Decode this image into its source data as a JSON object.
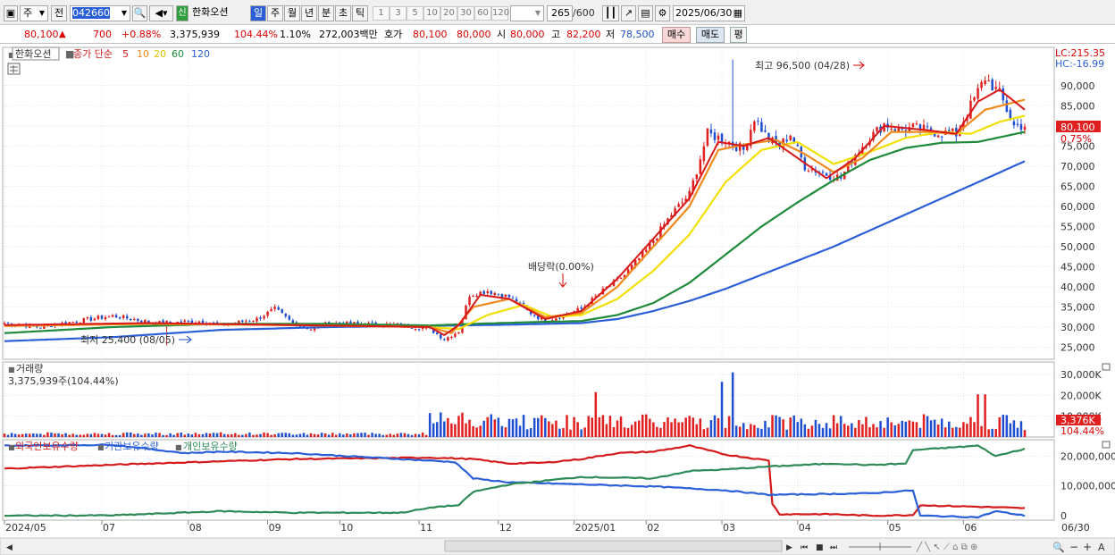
{
  "toolbar": {
    "period_type": "주",
    "prev_label": "전",
    "stock_code": "042660",
    "market_badge": "신",
    "stock_name": "한화오션",
    "intervals": [
      "일",
      "주",
      "월",
      "년",
      "분",
      "초",
      "틱"
    ],
    "active_interval": "일",
    "periods": [
      "1",
      "3",
      "5",
      "10",
      "20",
      "30",
      "60",
      "120"
    ],
    "count": "265",
    "count_total": "/600",
    "date": "2025/06/30"
  },
  "quote": {
    "price": "80,100",
    "change": "700",
    "change_pct": "+0.88%",
    "volume": "3,375,939",
    "volume_ratio": "104.44%",
    "turnover": "1.10%",
    "amount": "272,003백만",
    "hoga_label": "호가",
    "hoga1": "80,100",
    "hoga2": "80,000",
    "open_label": "시",
    "open": "80,000",
    "high_label": "고",
    "high": "82,200",
    "low_label": "저",
    "low": "78,500",
    "buy_label": "매수",
    "sell_label": "매도",
    "eval_label": "평"
  },
  "colors": {
    "up": "#e02020",
    "down": "#1f4fd1",
    "ma5": "#d81818",
    "ma10": "#f08a1c",
    "ma20": "#f2e000",
    "ma60": "#1e8a3a",
    "ma120": "#2b5fd8",
    "foreign": "#d41c1c",
    "institution": "#2b5fd8",
    "individual": "#2e8b57"
  },
  "chart_data": [
    {
      "type": "candlestick",
      "title": "한화오션",
      "legend": {
        "label": "종가 단순",
        "periods": [
          "5",
          "10",
          "20",
          "60",
          "120"
        ]
      },
      "y_tick_labels": [
        "25,000",
        "30,000",
        "35,000",
        "40,000",
        "45,000",
        "50,000",
        "55,000",
        "60,000",
        "65,000",
        "70,000",
        "75,000",
        "80,000",
        "85,000",
        "90,000"
      ],
      "ylim": [
        22000,
        99500
      ],
      "lc_label": "LC:215.35",
      "hc_label": "HC:-16.99",
      "last_price_label": "80,100",
      "last_change_label": "0.75%",
      "annotations": {
        "high": "최고 96,500 (04/28)",
        "low": "최저 25,400 (08/05)",
        "dividend": "배당락(0.00%)"
      },
      "price_points": [
        [
          0,
          31000
        ],
        [
          10,
          30000
        ],
        [
          20,
          31500
        ],
        [
          30,
          32800
        ],
        [
          42,
          31000
        ],
        [
          55,
          31500
        ],
        [
          60,
          30500
        ],
        [
          70,
          32000
        ],
        [
          75,
          34500
        ],
        [
          80,
          31000
        ],
        [
          85,
          29500
        ],
        [
          90,
          31000
        ],
        [
          100,
          30800
        ],
        [
          110,
          30500
        ],
        [
          118,
          29500
        ],
        [
          122,
          27000
        ],
        [
          126,
          29000
        ],
        [
          129,
          38000
        ],
        [
          134,
          39000
        ],
        [
          140,
          37500
        ],
        [
          145,
          34000
        ],
        [
          150,
          31500
        ],
        [
          155,
          33000
        ],
        [
          160,
          34500
        ],
        [
          166,
          39000
        ],
        [
          172,
          43000
        ],
        [
          178,
          49000
        ],
        [
          185,
          58000
        ],
        [
          190,
          63000
        ],
        [
          195,
          78000
        ],
        [
          200,
          76500
        ],
        [
          205,
          74000
        ],
        [
          208,
          82000
        ],
        [
          212,
          76500
        ],
        [
          215,
          75000
        ],
        [
          218,
          78000
        ],
        [
          222,
          70000
        ],
        [
          228,
          68000
        ],
        [
          232,
          67000
        ],
        [
          236,
          73000
        ],
        [
          240,
          77000
        ],
        [
          244,
          80500
        ],
        [
          248,
          79000
        ],
        [
          252,
          79500
        ],
        [
          258,
          78500
        ],
        [
          264,
          78000
        ],
        [
          268,
          85000
        ],
        [
          272,
          92000
        ],
        [
          276,
          88000
        ],
        [
          280,
          80000
        ],
        [
          283,
          80100
        ]
      ],
      "ma_points": {
        "5": [
          [
            0,
            30500
          ],
          [
            40,
            31000
          ],
          [
            80,
            30500
          ],
          [
            118,
            30000
          ],
          [
            122,
            28000
          ],
          [
            126,
            30500
          ],
          [
            132,
            38000
          ],
          [
            140,
            37000
          ],
          [
            150,
            32000
          ],
          [
            160,
            34000
          ],
          [
            170,
            42000
          ],
          [
            180,
            52000
          ],
          [
            190,
            62000
          ],
          [
            198,
            76000
          ],
          [
            205,
            75000
          ],
          [
            212,
            77000
          ],
          [
            220,
            72000
          ],
          [
            228,
            67000
          ],
          [
            236,
            72000
          ],
          [
            244,
            80000
          ],
          [
            255,
            79000
          ],
          [
            264,
            78000
          ],
          [
            270,
            86000
          ],
          [
            276,
            89000
          ],
          [
            283,
            84000
          ]
        ],
        "10": [
          [
            0,
            30300
          ],
          [
            40,
            30800
          ],
          [
            80,
            30500
          ],
          [
            118,
            30000
          ],
          [
            124,
            28500
          ],
          [
            130,
            35000
          ],
          [
            140,
            37000
          ],
          [
            150,
            32500
          ],
          [
            160,
            33500
          ],
          [
            170,
            40000
          ],
          [
            180,
            50000
          ],
          [
            190,
            60000
          ],
          [
            198,
            74000
          ],
          [
            206,
            75500
          ],
          [
            214,
            76500
          ],
          [
            222,
            73000
          ],
          [
            230,
            68500
          ],
          [
            238,
            72000
          ],
          [
            246,
            78500
          ],
          [
            256,
            78500
          ],
          [
            264,
            78000
          ],
          [
            272,
            84000
          ],
          [
            283,
            86500
          ]
        ],
        "20": [
          [
            0,
            30300
          ],
          [
            40,
            30800
          ],
          [
            80,
            30500
          ],
          [
            118,
            30000
          ],
          [
            126,
            29500
          ],
          [
            134,
            33000
          ],
          [
            144,
            35500
          ],
          [
            152,
            32500
          ],
          [
            160,
            33000
          ],
          [
            170,
            37000
          ],
          [
            180,
            44000
          ],
          [
            190,
            53000
          ],
          [
            200,
            66000
          ],
          [
            210,
            74000
          ],
          [
            220,
            76000
          ],
          [
            230,
            70500
          ],
          [
            240,
            73500
          ],
          [
            250,
            77000
          ],
          [
            260,
            78500
          ],
          [
            268,
            78000
          ],
          [
            276,
            81000
          ],
          [
            283,
            82500
          ]
        ],
        "60": [
          [
            0,
            28500
          ],
          [
            30,
            30000
          ],
          [
            60,
            30800
          ],
          [
            90,
            30800
          ],
          [
            118,
            30400
          ],
          [
            130,
            30800
          ],
          [
            145,
            31200
          ],
          [
            160,
            31500
          ],
          [
            170,
            33000
          ],
          [
            180,
            36000
          ],
          [
            190,
            41000
          ],
          [
            200,
            48000
          ],
          [
            210,
            55000
          ],
          [
            220,
            61000
          ],
          [
            230,
            66500
          ],
          [
            240,
            71500
          ],
          [
            250,
            74500
          ],
          [
            260,
            75800
          ],
          [
            270,
            76000
          ],
          [
            283,
            78500
          ]
        ],
        "120": [
          [
            0,
            26500
          ],
          [
            30,
            27500
          ],
          [
            60,
            29300
          ],
          [
            90,
            30000
          ],
          [
            118,
            30300
          ],
          [
            140,
            30600
          ],
          [
            160,
            31000
          ],
          [
            170,
            32000
          ],
          [
            180,
            34000
          ],
          [
            190,
            36500
          ],
          [
            200,
            39500
          ],
          [
            210,
            43000
          ],
          [
            220,
            46500
          ],
          [
            230,
            50000
          ],
          [
            240,
            54000
          ],
          [
            250,
            58000
          ],
          [
            260,
            62000
          ],
          [
            270,
            66000
          ],
          [
            283,
            71200
          ]
        ]
      },
      "n_bars": 284
    },
    {
      "type": "bar",
      "title": "거래량",
      "value_label": "3,375,939주(104.44%)",
      "y_tick_labels": [
        "10,000K",
        "20,000K",
        "30,000K"
      ],
      "ylim": [
        0,
        36000000
      ],
      "last_volume_label": "3,376K",
      "last_ratio_label": "104.44%"
    },
    {
      "type": "line",
      "series": [
        {
          "name": "외국인보유수량",
          "values": [
            [
              0,
              15800000
            ],
            [
              40,
              17500000
            ],
            [
              80,
              19000000
            ],
            [
              118,
              19500000
            ],
            [
              130,
              19000000
            ],
            [
              140,
              17500000
            ],
            [
              150,
              17800000
            ],
            [
              160,
              19000000
            ],
            [
              170,
              21000000
            ],
            [
              180,
              21500000
            ],
            [
              190,
              23500000
            ],
            [
              200,
              20500000
            ],
            [
              212,
              18500000
            ],
            [
              213,
              4000000
            ],
            [
              215,
              500000
            ],
            [
              230,
              500000
            ],
            [
              240,
              0
            ],
            [
              252,
              200000
            ],
            [
              254,
              3500000
            ],
            [
              270,
              3000000
            ],
            [
              283,
              2500000
            ]
          ]
        },
        {
          "name": "기관보유수량",
          "values": [
            [
              0,
              23500000
            ],
            [
              30,
              23800000
            ],
            [
              50,
              21000000
            ],
            [
              60,
              21500000
            ],
            [
              80,
              21000000
            ],
            [
              110,
              19000000
            ],
            [
              125,
              18000000
            ],
            [
              130,
              12500000
            ],
            [
              140,
              11200000
            ],
            [
              160,
              10500000
            ],
            [
              180,
              9800000
            ],
            [
              200,
              8500000
            ],
            [
              212,
              7000000
            ],
            [
              240,
              7500000
            ],
            [
              252,
              8500000
            ],
            [
              254,
              0
            ],
            [
              270,
              -500000
            ],
            [
              275,
              1500000
            ],
            [
              283,
              0
            ]
          ]
        },
        {
          "name": "개인보유수량",
          "values": [
            [
              0,
              0
            ],
            [
              30,
              100000
            ],
            [
              60,
              1500000
            ],
            [
              80,
              1000000
            ],
            [
              110,
              1000000
            ],
            [
              120,
              3000000
            ],
            [
              126,
              3500000
            ],
            [
              130,
              8000000
            ],
            [
              140,
              10500000
            ],
            [
              160,
              13000000
            ],
            [
              180,
              12500000
            ],
            [
              190,
              15000000
            ],
            [
              200,
              15500000
            ],
            [
              212,
              16500000
            ],
            [
              230,
              17500000
            ],
            [
              240,
              17000000
            ],
            [
              250,
              17500000
            ],
            [
              252,
              22000000
            ],
            [
              270,
              23500000
            ],
            [
              275,
              20000000
            ],
            [
              283,
              22500000
            ]
          ]
        }
      ],
      "y_tick_labels": [
        "0",
        "10,000,000",
        "20,000,000"
      ],
      "ylim": [
        -1500000,
        25500000
      ]
    }
  ],
  "x_axis": {
    "labels": [
      [
        "2024/05",
        0
      ],
      [
        "07",
        27
      ],
      [
        "08",
        51
      ],
      [
        "09",
        73
      ],
      [
        "10",
        93
      ],
      [
        "11",
        115
      ],
      [
        "12",
        137
      ],
      [
        "2025/01",
        158
      ],
      [
        "02",
        178
      ],
      [
        "03",
        199
      ],
      [
        "04",
        220
      ],
      [
        "05",
        245
      ],
      [
        "06",
        266
      ]
    ],
    "end_label": "06/30"
  }
}
